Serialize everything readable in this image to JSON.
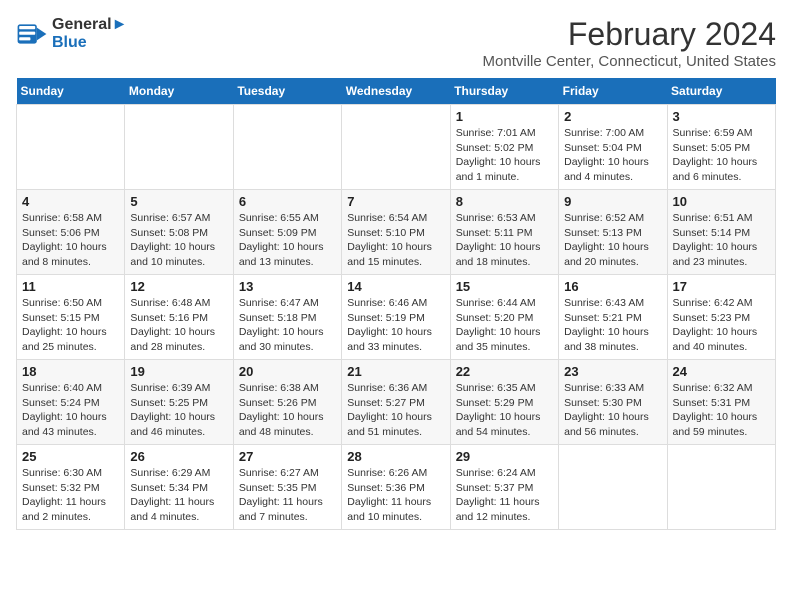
{
  "header": {
    "logo_line1": "General",
    "logo_line2": "Blue",
    "month_year": "February 2024",
    "location": "Montville Center, Connecticut, United States"
  },
  "weekdays": [
    "Sunday",
    "Monday",
    "Tuesday",
    "Wednesday",
    "Thursday",
    "Friday",
    "Saturday"
  ],
  "weeks": [
    [
      {
        "day": "",
        "detail": ""
      },
      {
        "day": "",
        "detail": ""
      },
      {
        "day": "",
        "detail": ""
      },
      {
        "day": "",
        "detail": ""
      },
      {
        "day": "1",
        "detail": "Sunrise: 7:01 AM\nSunset: 5:02 PM\nDaylight: 10 hours\nand 1 minute."
      },
      {
        "day": "2",
        "detail": "Sunrise: 7:00 AM\nSunset: 5:04 PM\nDaylight: 10 hours\nand 4 minutes."
      },
      {
        "day": "3",
        "detail": "Sunrise: 6:59 AM\nSunset: 5:05 PM\nDaylight: 10 hours\nand 6 minutes."
      }
    ],
    [
      {
        "day": "4",
        "detail": "Sunrise: 6:58 AM\nSunset: 5:06 PM\nDaylight: 10 hours\nand 8 minutes."
      },
      {
        "day": "5",
        "detail": "Sunrise: 6:57 AM\nSunset: 5:08 PM\nDaylight: 10 hours\nand 10 minutes."
      },
      {
        "day": "6",
        "detail": "Sunrise: 6:55 AM\nSunset: 5:09 PM\nDaylight: 10 hours\nand 13 minutes."
      },
      {
        "day": "7",
        "detail": "Sunrise: 6:54 AM\nSunset: 5:10 PM\nDaylight: 10 hours\nand 15 minutes."
      },
      {
        "day": "8",
        "detail": "Sunrise: 6:53 AM\nSunset: 5:11 PM\nDaylight: 10 hours\nand 18 minutes."
      },
      {
        "day": "9",
        "detail": "Sunrise: 6:52 AM\nSunset: 5:13 PM\nDaylight: 10 hours\nand 20 minutes."
      },
      {
        "day": "10",
        "detail": "Sunrise: 6:51 AM\nSunset: 5:14 PM\nDaylight: 10 hours\nand 23 minutes."
      }
    ],
    [
      {
        "day": "11",
        "detail": "Sunrise: 6:50 AM\nSunset: 5:15 PM\nDaylight: 10 hours\nand 25 minutes."
      },
      {
        "day": "12",
        "detail": "Sunrise: 6:48 AM\nSunset: 5:16 PM\nDaylight: 10 hours\nand 28 minutes."
      },
      {
        "day": "13",
        "detail": "Sunrise: 6:47 AM\nSunset: 5:18 PM\nDaylight: 10 hours\nand 30 minutes."
      },
      {
        "day": "14",
        "detail": "Sunrise: 6:46 AM\nSunset: 5:19 PM\nDaylight: 10 hours\nand 33 minutes."
      },
      {
        "day": "15",
        "detail": "Sunrise: 6:44 AM\nSunset: 5:20 PM\nDaylight: 10 hours\nand 35 minutes."
      },
      {
        "day": "16",
        "detail": "Sunrise: 6:43 AM\nSunset: 5:21 PM\nDaylight: 10 hours\nand 38 minutes."
      },
      {
        "day": "17",
        "detail": "Sunrise: 6:42 AM\nSunset: 5:23 PM\nDaylight: 10 hours\nand 40 minutes."
      }
    ],
    [
      {
        "day": "18",
        "detail": "Sunrise: 6:40 AM\nSunset: 5:24 PM\nDaylight: 10 hours\nand 43 minutes."
      },
      {
        "day": "19",
        "detail": "Sunrise: 6:39 AM\nSunset: 5:25 PM\nDaylight: 10 hours\nand 46 minutes."
      },
      {
        "day": "20",
        "detail": "Sunrise: 6:38 AM\nSunset: 5:26 PM\nDaylight: 10 hours\nand 48 minutes."
      },
      {
        "day": "21",
        "detail": "Sunrise: 6:36 AM\nSunset: 5:27 PM\nDaylight: 10 hours\nand 51 minutes."
      },
      {
        "day": "22",
        "detail": "Sunrise: 6:35 AM\nSunset: 5:29 PM\nDaylight: 10 hours\nand 54 minutes."
      },
      {
        "day": "23",
        "detail": "Sunrise: 6:33 AM\nSunset: 5:30 PM\nDaylight: 10 hours\nand 56 minutes."
      },
      {
        "day": "24",
        "detail": "Sunrise: 6:32 AM\nSunset: 5:31 PM\nDaylight: 10 hours\nand 59 minutes."
      }
    ],
    [
      {
        "day": "25",
        "detail": "Sunrise: 6:30 AM\nSunset: 5:32 PM\nDaylight: 11 hours\nand 2 minutes."
      },
      {
        "day": "26",
        "detail": "Sunrise: 6:29 AM\nSunset: 5:34 PM\nDaylight: 11 hours\nand 4 minutes."
      },
      {
        "day": "27",
        "detail": "Sunrise: 6:27 AM\nSunset: 5:35 PM\nDaylight: 11 hours\nand 7 minutes."
      },
      {
        "day": "28",
        "detail": "Sunrise: 6:26 AM\nSunset: 5:36 PM\nDaylight: 11 hours\nand 10 minutes."
      },
      {
        "day": "29",
        "detail": "Sunrise: 6:24 AM\nSunset: 5:37 PM\nDaylight: 11 hours\nand 12 minutes."
      },
      {
        "day": "",
        "detail": ""
      },
      {
        "day": "",
        "detail": ""
      }
    ]
  ]
}
